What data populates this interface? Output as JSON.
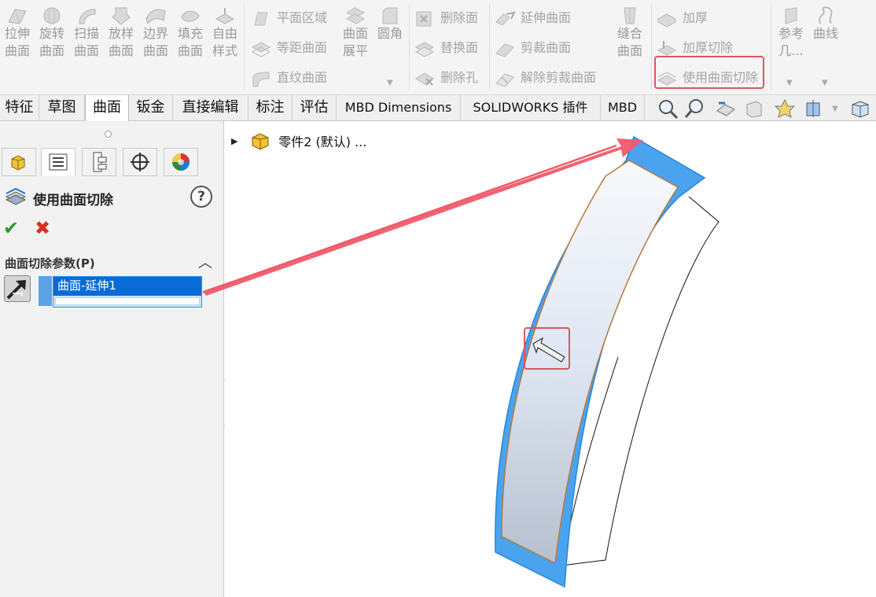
{
  "ribbon": {
    "big_buttons": [
      {
        "line1": "拉伸",
        "line2": "曲面",
        "icon": "extruded-surface-icon"
      },
      {
        "line1": "旋转",
        "line2": "曲面",
        "icon": "revolved-surface-icon"
      },
      {
        "line1": "扫描",
        "line2": "曲面",
        "icon": "swept-surface-icon"
      },
      {
        "line1": "放样",
        "line2": "曲面",
        "icon": "lofted-surface-icon"
      },
      {
        "line1": "边界",
        "line2": "曲面",
        "icon": "boundary-surface-icon"
      },
      {
        "line1": "填充",
        "line2": "曲面",
        "icon": "filled-surface-icon"
      },
      {
        "line1": "自由",
        "line2": "样式",
        "icon": "freeform-icon"
      }
    ],
    "group2": {
      "rows": [
        "平面区域",
        "等距曲面",
        "直纹曲面"
      ],
      "flatten_line1": "曲面",
      "flatten_line2": "展平",
      "fillet": "圆角"
    },
    "group3": {
      "rows": [
        "删除面",
        "替换面",
        "删除孔"
      ]
    },
    "group4": {
      "rows": [
        "延伸曲面",
        "剪裁曲面",
        "解除剪裁曲面"
      ],
      "knit_line1": "缝合",
      "knit_line2": "曲面"
    },
    "group5": {
      "rows": [
        "加厚",
        "加厚切除",
        "使用曲面切除"
      ]
    },
    "group6": {
      "ref_line1": "参考",
      "ref_line2": "几...",
      "curves": "曲线"
    }
  },
  "tabs": [
    "特征",
    "草图",
    "曲面",
    "钣金",
    "直接编辑",
    "标注",
    "评估",
    "MBD Dimensions",
    "SOLIDWORKS 插件",
    "MBD"
  ],
  "property_manager": {
    "title": "使用曲面切除",
    "help": "?",
    "ok": "✔",
    "cancel": "✖",
    "group_title": "曲面切除参数(P)",
    "collapse": "︿",
    "selected_surface": "曲面-延伸1"
  },
  "tree": {
    "expander": "▶",
    "label": "零件2 (默认) ..."
  },
  "colors": {
    "accent_highlight": "#e05461",
    "selection_blue": "#0a6bd6",
    "surface_edge": "#3b9af0"
  }
}
